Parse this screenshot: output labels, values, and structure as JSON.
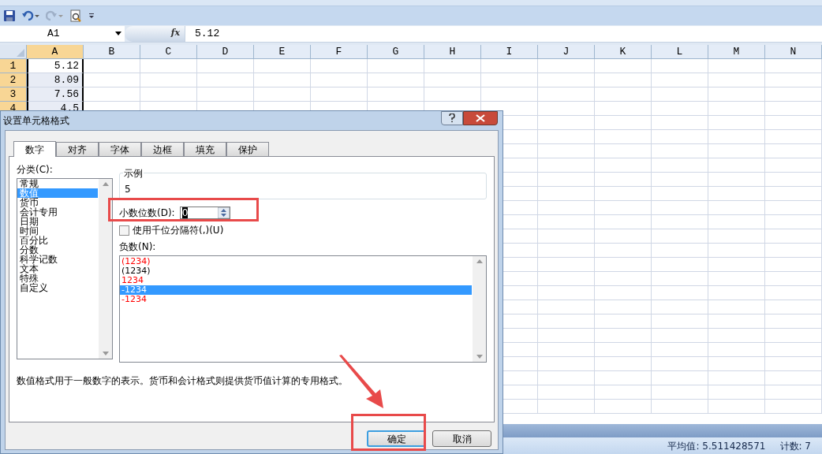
{
  "formula_bar": {
    "name_box": "A1",
    "fx": "fx",
    "value": "5.12"
  },
  "columns": [
    {
      "label": "A",
      "selected": true
    },
    {
      "label": "B",
      "selected": false
    },
    {
      "label": "C",
      "selected": false
    },
    {
      "label": "D",
      "selected": false
    },
    {
      "label": "E",
      "selected": false
    },
    {
      "label": "F",
      "selected": false
    },
    {
      "label": "G",
      "selected": false
    },
    {
      "label": "H",
      "selected": false
    },
    {
      "label": "I",
      "selected": false
    },
    {
      "label": "J",
      "selected": false
    },
    {
      "label": "K",
      "selected": false
    },
    {
      "label": "L",
      "selected": false
    },
    {
      "label": "M",
      "selected": false
    },
    {
      "label": "N",
      "selected": false
    }
  ],
  "rows": [
    {
      "label": "1",
      "selected": true,
      "value": "5.12"
    },
    {
      "label": "2",
      "selected": true,
      "value": "8.09"
    },
    {
      "label": "3",
      "selected": true,
      "value": "7.56"
    },
    {
      "label": "4",
      "selected": true,
      "value": "4.5"
    }
  ],
  "dialog": {
    "title": "设置单元格格式",
    "tabs": [
      {
        "label": "数字",
        "selected": true
      },
      {
        "label": "对齐",
        "selected": false
      },
      {
        "label": "字体",
        "selected": false
      },
      {
        "label": "边框",
        "selected": false
      },
      {
        "label": "填充",
        "selected": false
      },
      {
        "label": "保护",
        "selected": false
      }
    ],
    "category_label": "分类(C):",
    "categories": [
      {
        "label": "常规",
        "selected": false
      },
      {
        "label": "数值",
        "selected": true
      },
      {
        "label": "货币",
        "selected": false
      },
      {
        "label": "会计专用",
        "selected": false
      },
      {
        "label": "日期",
        "selected": false
      },
      {
        "label": "时间",
        "selected": false
      },
      {
        "label": "百分比",
        "selected": false
      },
      {
        "label": "分数",
        "selected": false
      },
      {
        "label": "科学记数",
        "selected": false
      },
      {
        "label": "文本",
        "selected": false
      },
      {
        "label": "特殊",
        "selected": false
      },
      {
        "label": "自定义",
        "selected": false
      }
    ],
    "sample": {
      "label": "示例",
      "value": "5"
    },
    "decimal_places": {
      "label": "小数位数(D):",
      "value": "0"
    },
    "thousands_separator": {
      "label": "使用千位分隔符(,)(U)",
      "checked": false
    },
    "negative_label": "负数(N):",
    "negatives": [
      {
        "label": "(1234)",
        "color": "#ff0000",
        "selected": false
      },
      {
        "label": "(1234)",
        "color": "#000000",
        "selected": false
      },
      {
        "label": "1234",
        "color": "#ff0000",
        "selected": false
      },
      {
        "label": "-1234",
        "selected": true
      },
      {
        "label": "-1234",
        "color": "#ff0000",
        "selected": false
      }
    ],
    "description": "数值格式用于一般数字的表示。货币和会计格式则提供货币值计算的专用格式。",
    "buttons": [
      {
        "label": "确定",
        "kind": "primary"
      },
      {
        "label": "取消",
        "kind": "normal"
      }
    ]
  },
  "status_bar": {
    "average": "平均值: 5.511428571",
    "count": "计数: 7"
  }
}
